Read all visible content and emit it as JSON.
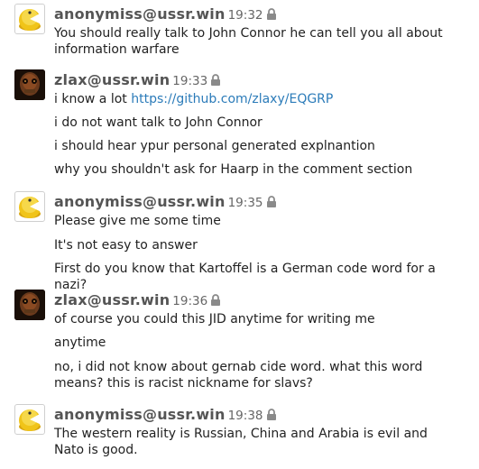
{
  "messages": [
    {
      "author": "anonymiss@ussr.win",
      "time": "19:32",
      "avatar": "pacman-avatar",
      "lines": [
        {
          "text": "You should really talk to John Connor he can tell you all about information warfare"
        }
      ]
    },
    {
      "author": "zlax@ussr.win",
      "time": "19:33",
      "avatar": "skull-avatar",
      "lines": [
        {
          "text": "i know a lot ",
          "link": "https://github.com/zlaxy/EQGRP"
        },
        {
          "text": "i do not want talk to John Connor"
        },
        {
          "text": "i should hear ypur personal generated explnantion"
        },
        {
          "text": "why you shouldn't ask for Haarp in the comment section"
        }
      ]
    },
    {
      "author": "anonymiss@ussr.win",
      "time": "19:35",
      "avatar": "pacman-avatar",
      "lines": [
        {
          "text": "Please give me some time"
        },
        {
          "text": "It's not easy to answer"
        },
        {
          "text": "First do you know that Kartoffel is a German code word for a nazi?"
        }
      ]
    },
    {
      "author": "zlax@ussr.win",
      "time": "19:36",
      "avatar": "skull-avatar",
      "lines": [
        {
          "text": "of course you could this JID anytime for writing me"
        },
        {
          "text": "anytime"
        },
        {
          "text": "no, i did not know about gernab cide word. what this word means? this is racist nickname for slavs?"
        }
      ]
    },
    {
      "author": "anonymiss@ussr.win",
      "time": "19:38",
      "avatar": "pacman-avatar",
      "lines": [
        {
          "text": "The western reality is Russian, China and Arabia is evil and Nato is good."
        }
      ]
    }
  ],
  "colors": {
    "author": "#555555",
    "time": "#666666",
    "text": "#222222",
    "link": "#2b7bb9",
    "pacman": "#f0c419"
  }
}
